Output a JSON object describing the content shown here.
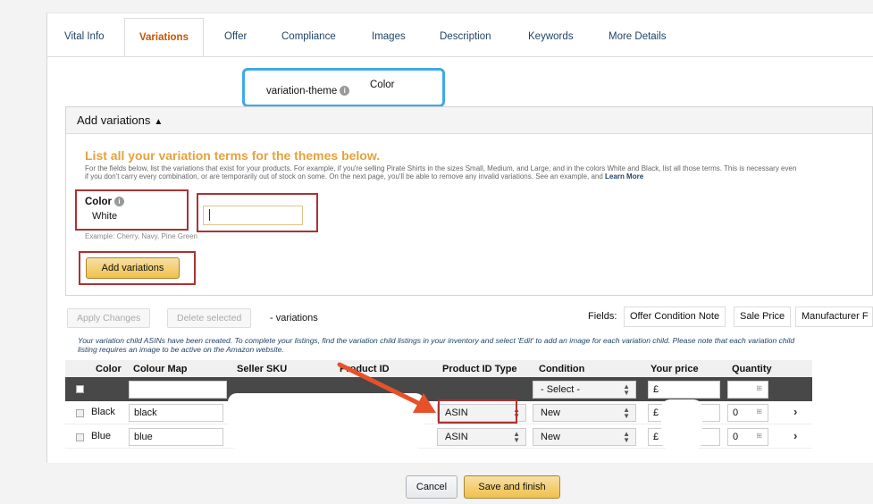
{
  "tabs": [
    "Vital Info",
    "Variations",
    "Offer",
    "Compliance",
    "Images",
    "Description",
    "Keywords",
    "More Details"
  ],
  "variation_theme": {
    "label": "variation-theme",
    "value": "Color"
  },
  "add_variations": {
    "header": "Add variations",
    "title": "List all your variation terms for the themes below.",
    "help": "For the fields below, list the variations that exist for your products. For example, if you're selling Pirate Shirts in the sizes Small, Medium, and Large, and in the colors White and Black, list all those terms. This is necessary even if you don't carry every combination, or are temporarily out of stock on some. On the next page, you'll be able to remove any invalid variations. See an example, and",
    "help_link": "Learn More",
    "color_label": "Color",
    "color_value": "White",
    "example": "Example: Cherry, Navy, Pine Green",
    "button": "Add variations"
  },
  "toolbar": {
    "apply": "Apply Changes",
    "delete": "Delete selected",
    "variations_suffix": "- variations",
    "fields_label": "Fields:",
    "field_buttons": [
      "Offer Condition Note",
      "Sale Price",
      "Manufacturer F"
    ]
  },
  "notice": "Your variation child ASINs have been created. To complete your listings, find the variation child listings in your inventory and select 'Edit' to add an image for each variation child. Please note that each variation child listing requires an image to be active on the Amazon website.",
  "table": {
    "headers": [
      "Color",
      "Colour Map",
      "Seller SKU",
      "Product ID",
      "Product ID Type",
      "Condition",
      "Your price",
      "Quantity"
    ],
    "bulk_condition": "- Select -",
    "currency": "£",
    "rows": [
      {
        "color": "Black",
        "colour_map": "black",
        "id_type": "ASIN",
        "condition": "New",
        "quantity": "0"
      },
      {
        "color": "Blue",
        "colour_map": "blue",
        "id_type": "ASIN",
        "condition": "New",
        "quantity": "0"
      }
    ]
  },
  "footer": {
    "cancel": "Cancel",
    "save": "Save and finish"
  },
  "colors": {
    "accent_orange": "#e6a23c",
    "highlight_blue": "#3fa9e8",
    "annotation_red": "#a33333",
    "arrow": "#e8502a"
  }
}
